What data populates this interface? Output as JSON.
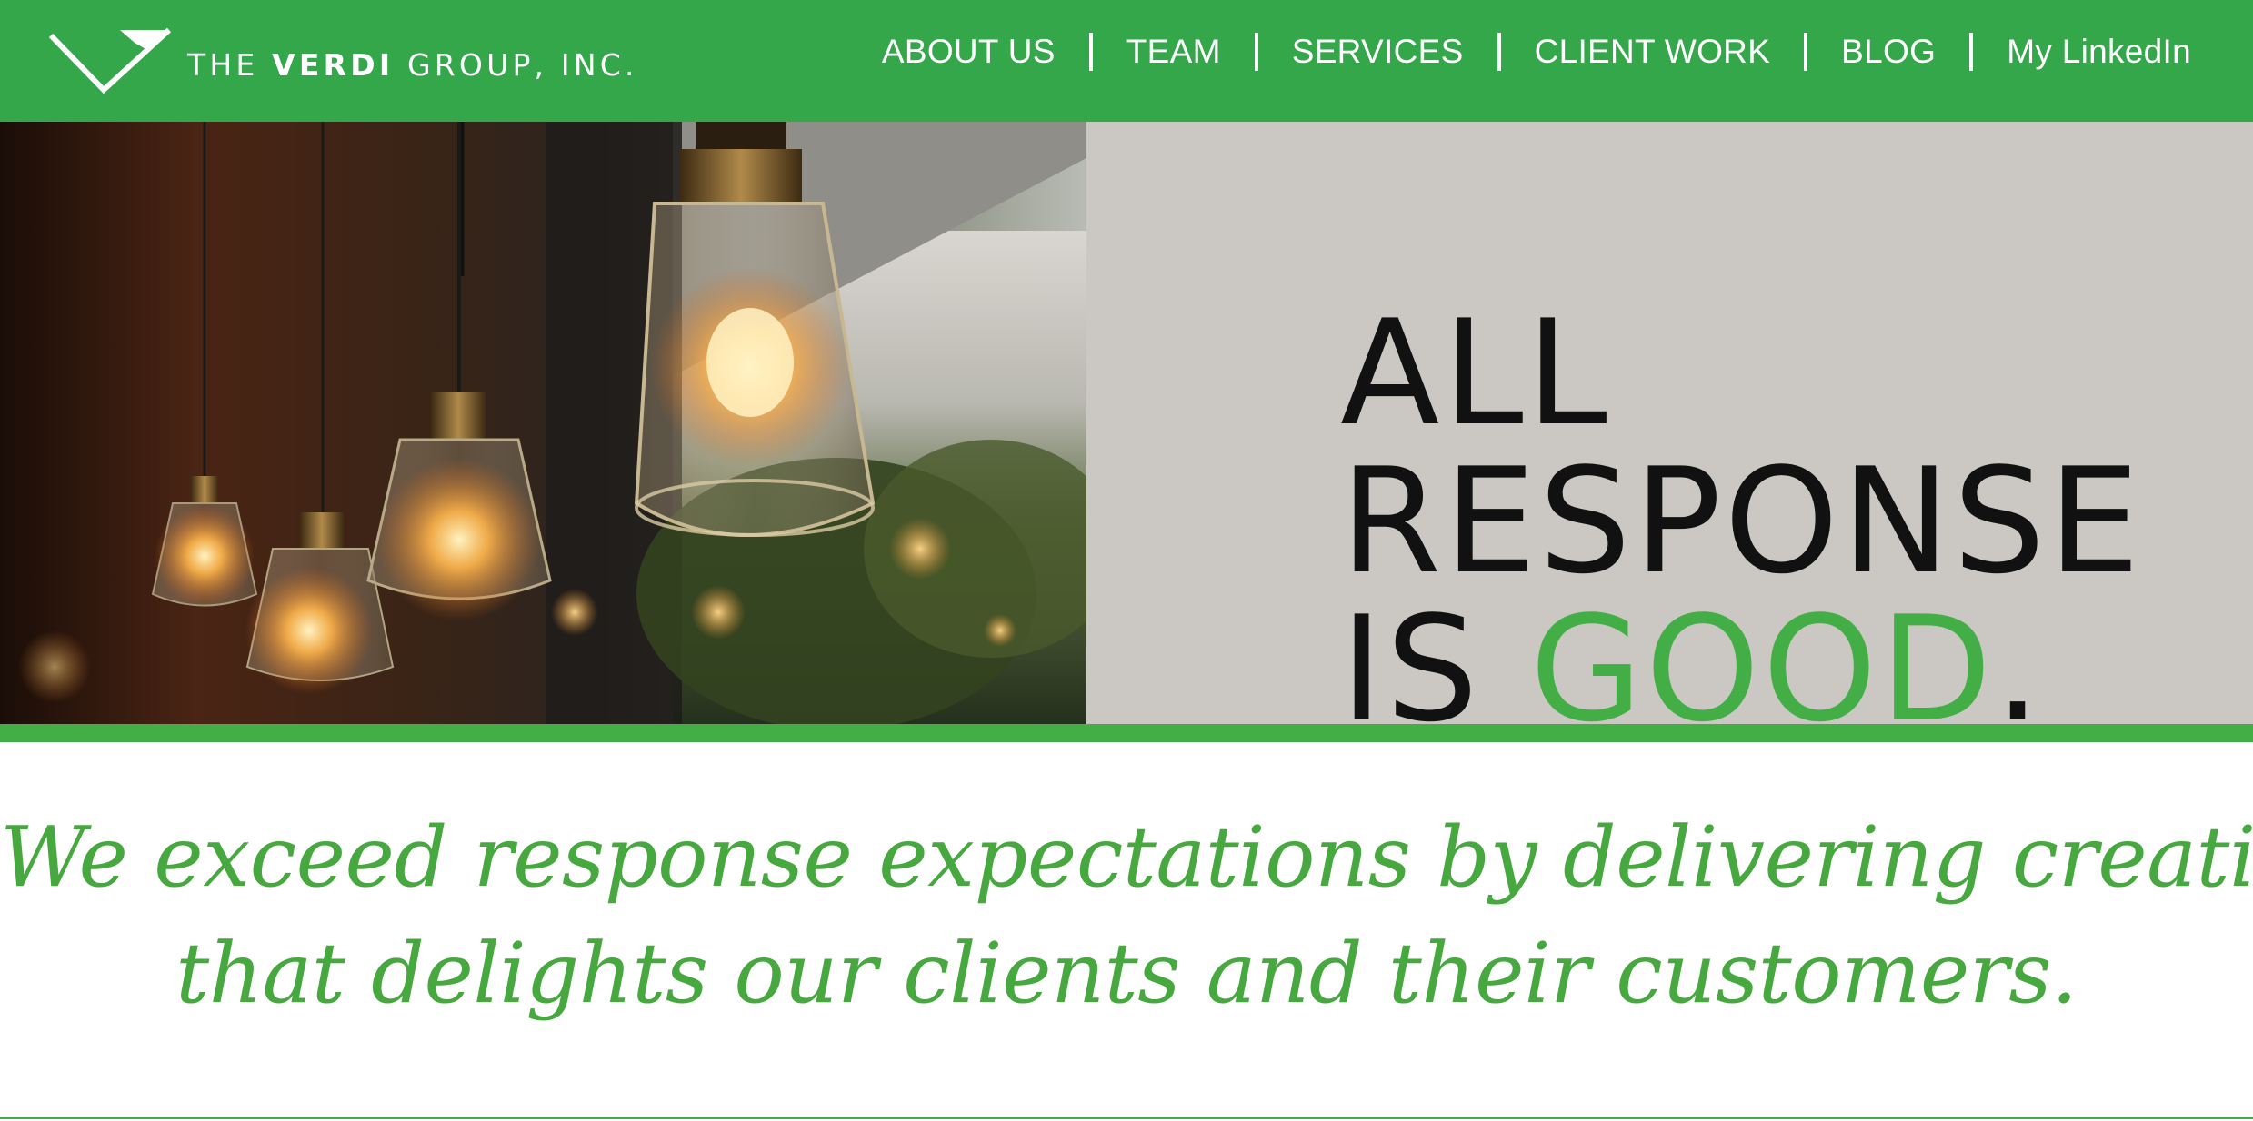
{
  "header": {
    "logo": {
      "text_light": "THE",
      "text_bold": "VERDI",
      "text_rest": "GROUP, INC.",
      "icon": "check-v-logo-icon"
    },
    "nav": [
      {
        "label": "ABOUT US"
      },
      {
        "label": "TEAM"
      },
      {
        "label": "SERVICES"
      },
      {
        "label": "CLIENT WORK"
      },
      {
        "label": "BLOG"
      },
      {
        "label": "My LinkedIn"
      }
    ]
  },
  "hero": {
    "headline_line1": "ALL",
    "headline_line2": "RESPONSE",
    "headline_line3_prefix": "IS",
    "headline_line3_accent": "GOOD",
    "headline_line3_suffix": ".",
    "image": "hanging-edison-bulb-lamps-photo"
  },
  "tagline": {
    "line1": "We exceed response expectations by delivering creative",
    "line2": "that delights our clients and their customers."
  },
  "colors": {
    "brand_green": "#34a74b",
    "accent_green": "#43ad46",
    "hero_panel_gray": "#cbc8c3",
    "headline_black": "#111111",
    "nav_text": "#ffffff"
  }
}
